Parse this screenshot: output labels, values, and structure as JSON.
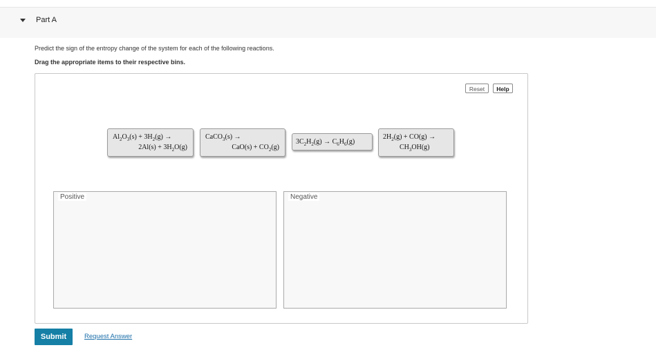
{
  "part": {
    "title": "Part A"
  },
  "instructions": "Predict the sign of the entropy change of the system for each of the following reactions.",
  "drag_note": "Drag the appropriate items to their respective bins.",
  "buttons": {
    "reset": "Reset",
    "help": "Help",
    "submit": "Submit",
    "request_answer": "Request Answer"
  },
  "items": [
    {
      "line1": "Al<sub>2</sub>O<sub>3</sub>(s) + 3H<sub>2</sub>(g) →",
      "line2": "2Al(s) + 3H<sub>2</sub>O(g)"
    },
    {
      "line1": "CaCO<sub>3</sub>(s) →",
      "line2": "CaO(s) + CO<sub>2</sub>(g)"
    },
    {
      "line1": "3C<sub>2</sub>H<sub>2</sub>(g) → C<sub>6</sub>H<sub>6</sub>(g)",
      "line2": ""
    },
    {
      "line1": "2H<sub>2</sub>(g) + CO(g) →",
      "line2": "CH<sub>3</sub>OH(g)"
    }
  ],
  "bins": [
    {
      "label": "Positive"
    },
    {
      "label": "Negative"
    }
  ],
  "colors": {
    "submit_bg": "#157fa6",
    "link": "#1a6ea8",
    "tile_bg": "#e6e6e6"
  }
}
